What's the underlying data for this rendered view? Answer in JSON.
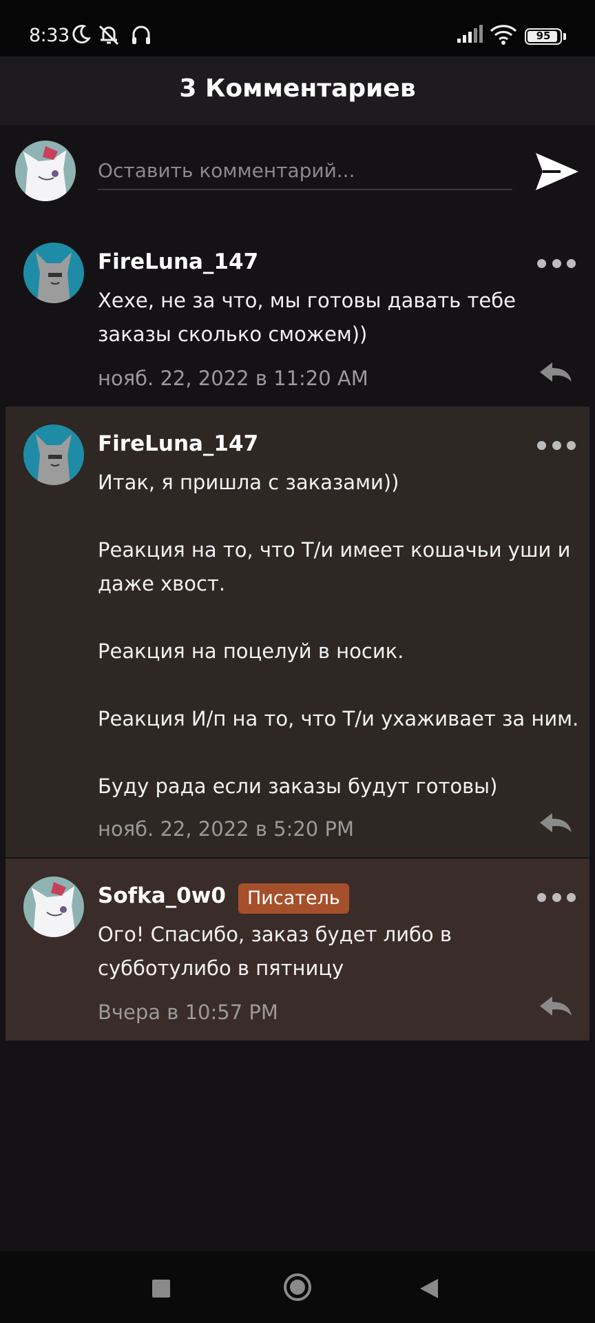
{
  "status_bar": {
    "time": "8:33",
    "battery": "95",
    "battery_level": 0.95,
    "icons": [
      "moon-icon",
      "notifications-off-icon",
      "headphones-icon",
      "signal-icon",
      "wifi-icon",
      "battery-icon"
    ]
  },
  "header": {
    "title": "3 Комментариев"
  },
  "compose": {
    "placeholder": "Оставить комментарий...",
    "value": "",
    "send_icon": "send-icon"
  },
  "comments": [
    {
      "author": "FireLuna_147",
      "badge": "",
      "lines": [
        "Хехе, не за что, мы готовы давать тебе",
        "заказы сколько сможем))"
      ],
      "date": "нояб. 22, 2022 в 11:20 AM",
      "highlight_color": "#141215"
    },
    {
      "author": "FireLuna_147",
      "badge": "",
      "lines": [
        "Итак, я пришла с заказами))",
        "",
        "Реакция на то, что Т/и имеет кошачьи уши и",
        "даже хвост.",
        "",
        "Реакция на поцелуй в носик.",
        "",
        "Реакция И/п на то, что Т/и ухаживает за ним.",
        "",
        "Буду рада если заказы будут готовы)"
      ],
      "date": "нояб. 22, 2022 в 5:20 PM",
      "highlight_color": "#2e2724"
    },
    {
      "author": "Sofka_0w0",
      "badge": "Писатель",
      "lines": [
        "Ого! Спасибо, заказ будет либо в",
        "субботулибо в пятницу"
      ],
      "date": "Вчера в 10:57 PM",
      "highlight_color": "#3a2c29"
    }
  ],
  "colors": {
    "background": "#141215",
    "header": "#1d1b1e",
    "badge": "#a64f2b",
    "muted_text": "#9a9a9a"
  }
}
